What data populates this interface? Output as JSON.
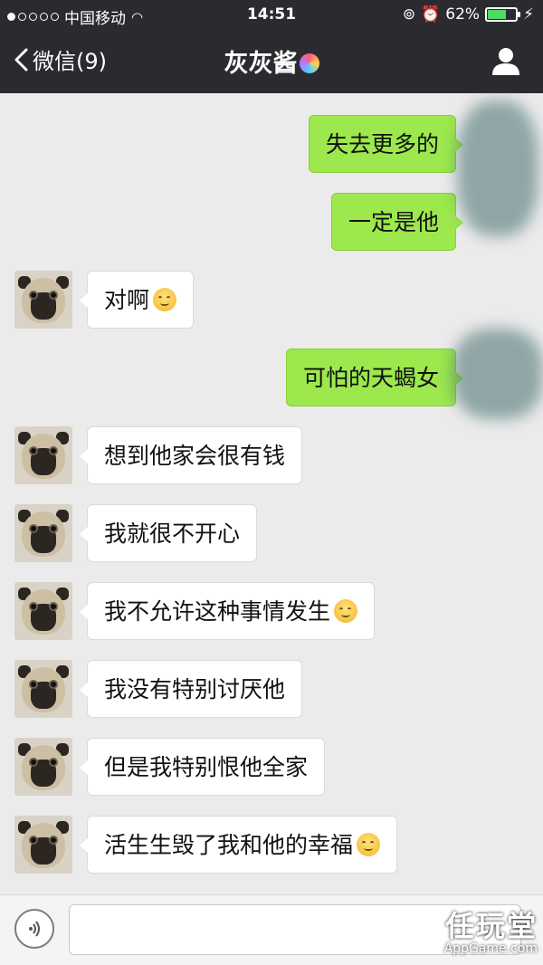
{
  "status_bar": {
    "carrier": "中国移动",
    "time": "14:51",
    "battery": "62%",
    "battery_level": 0.62
  },
  "nav": {
    "back_label": "微信(9)",
    "title": "灰灰酱"
  },
  "messages": [
    {
      "side": "out",
      "text": "失去更多的"
    },
    {
      "side": "out",
      "text": "一定是他"
    },
    {
      "side": "in",
      "text": "对啊",
      "emoji": "smile"
    },
    {
      "side": "out",
      "text": "可怕的天蝎女"
    },
    {
      "side": "in",
      "text": "想到他家会很有钱"
    },
    {
      "side": "in",
      "text": "我就很不开心"
    },
    {
      "side": "in",
      "text": "我不允许这种事情发生",
      "emoji": "smile"
    },
    {
      "side": "in",
      "text": "我没有特别讨厌他"
    },
    {
      "side": "in",
      "text": "但是我特别恨他全家"
    },
    {
      "side": "in",
      "text": "活生生毁了我和他的幸福",
      "emoji": "smile"
    }
  ],
  "watermark": {
    "brand": "任玩堂",
    "site": "AppGame.com"
  },
  "icons": {
    "back": "chevron-left-icon",
    "profile": "person-icon",
    "voice": "voice-icon",
    "emoji": "smile-emoji-icon"
  }
}
